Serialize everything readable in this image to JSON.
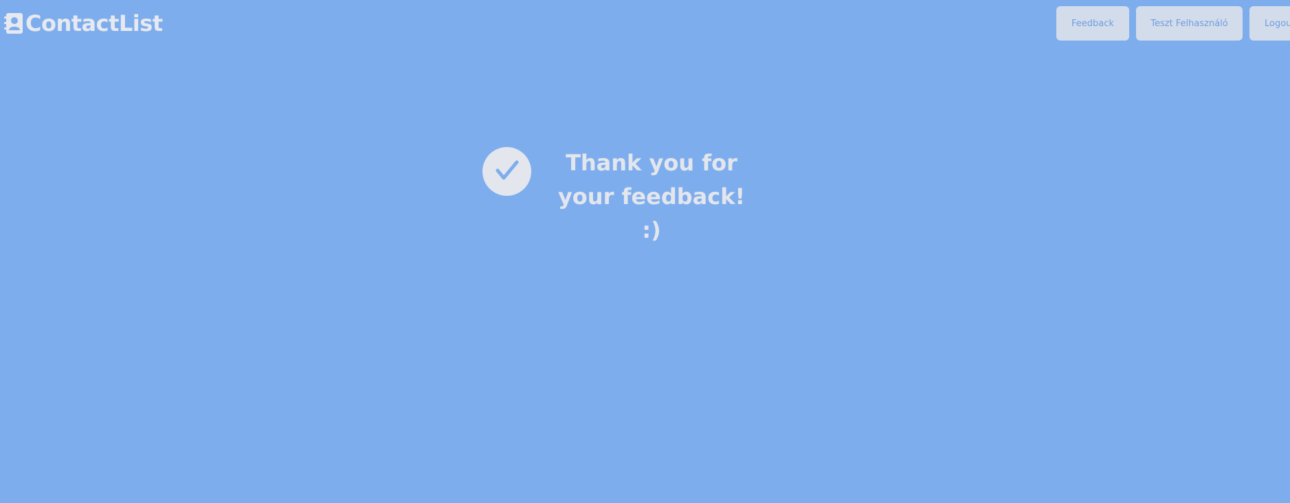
{
  "header": {
    "brand_title": "ContactList",
    "brand_icon": "contact-book-icon",
    "nav": {
      "feedback_label": "Feedback",
      "user_label": "Teszt Felhasználó",
      "logout_label": "Logout"
    }
  },
  "main": {
    "status_icon": "check-icon",
    "message_line1": "Thank you for",
    "message_line2": "your feedback! :)"
  },
  "colors": {
    "background": "#7eadee",
    "button_bg": "#d3dcea",
    "button_text": "#6f9ee0",
    "text_light": "#e3e6ec"
  }
}
